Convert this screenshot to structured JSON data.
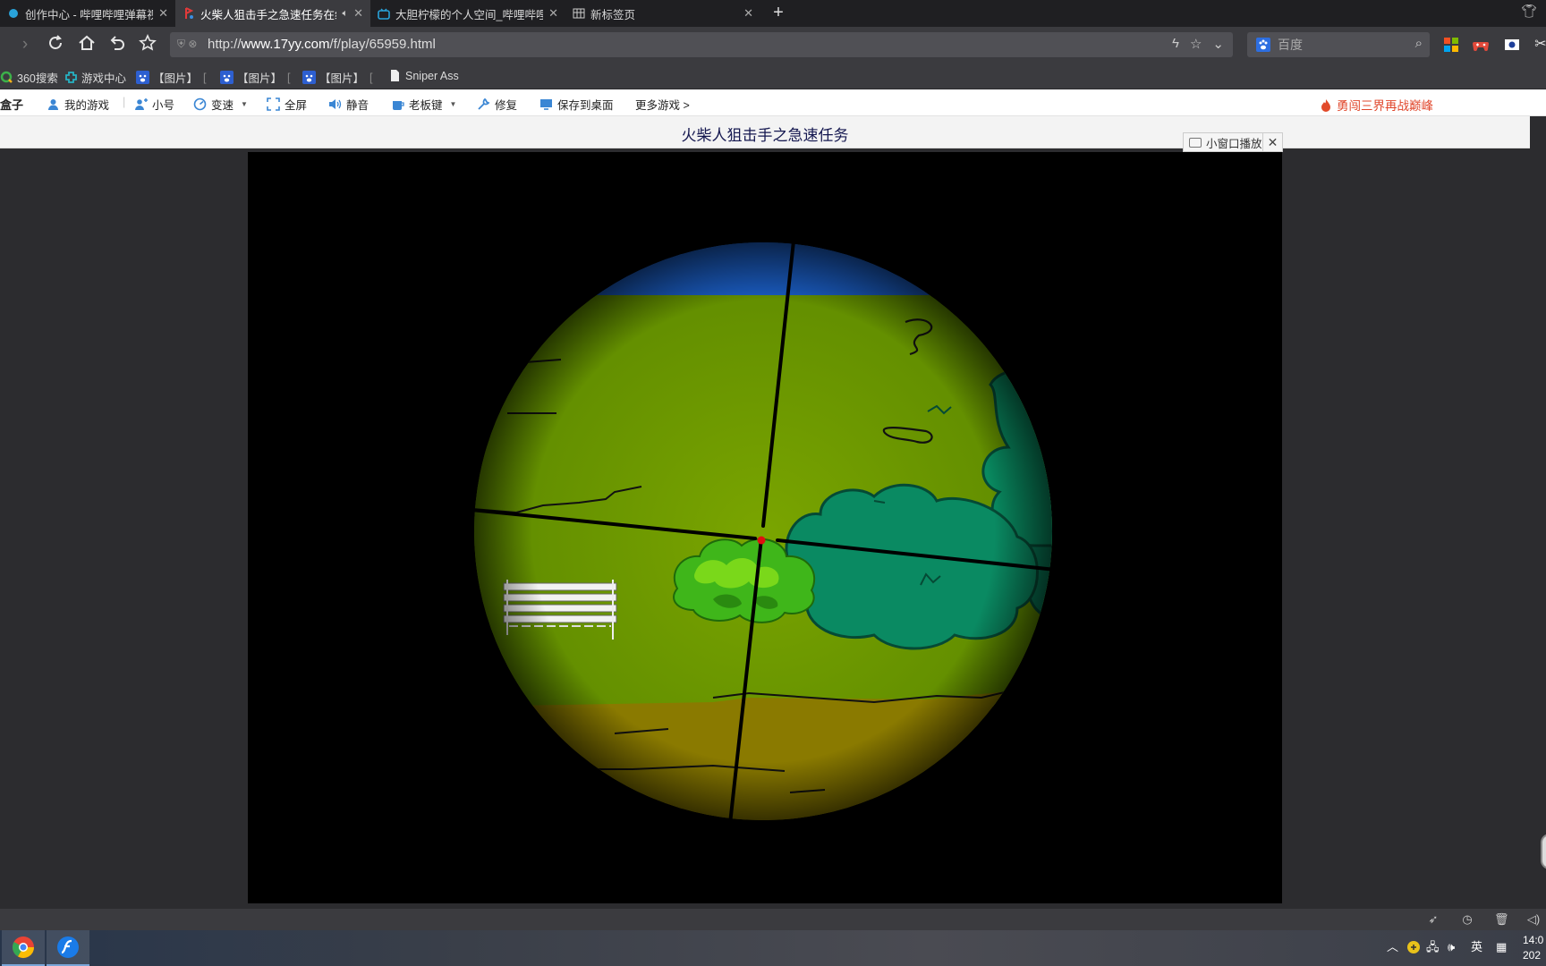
{
  "tabs": [
    {
      "title": "创作中心 - 哔哩哔哩弹幕视频",
      "active": false
    },
    {
      "title": "火柴人狙击手之急速任务在线",
      "active": true
    },
    {
      "title": "大胆柠檬的个人空间_哔哩哔哩",
      "active": false
    },
    {
      "title": "新标签页",
      "active": false
    }
  ],
  "navbar": {
    "url_prefix": "http://",
    "url_host": "www.17yy.com",
    "url_path": "/f/play/65959.html",
    "search_placeholder": "百度"
  },
  "bookmarks": [
    {
      "label": "360搜索",
      "icon": "360-search-icon"
    },
    {
      "label": "游戏中心",
      "icon": "game-center-icon"
    },
    {
      "label": "【图片】",
      "icon": "baidu-paw-icon"
    },
    {
      "label": "【图片】",
      "icon": "baidu-paw-icon"
    },
    {
      "label": "【图片】",
      "icon": "baidu-paw-icon"
    },
    {
      "label": "Sniper Ass",
      "icon": "page-icon"
    }
  ],
  "game_toolbar": {
    "brand": "盒子",
    "items": [
      {
        "label": "我的游戏",
        "icon": "user-icon"
      },
      {
        "label": "小号",
        "icon": "add-user-icon"
      },
      {
        "label": "变速",
        "icon": "speed-icon"
      },
      {
        "label": "全屏",
        "icon": "fullscreen-icon"
      },
      {
        "label": "静音",
        "icon": "speaker-icon"
      },
      {
        "label": "老板键",
        "icon": "boss-key-icon"
      },
      {
        "label": "修复",
        "icon": "wrench-icon"
      },
      {
        "label": "保存到桌面",
        "icon": "monitor-icon"
      },
      {
        "label": "更多游戏 >",
        "icon": ""
      }
    ],
    "promo": "勇闯三界再战巅峰"
  },
  "game": {
    "title": "火柴人狙击手之急速任务",
    "mini_play_label": "小窗口播放"
  },
  "taskbar": {
    "ime": "英",
    "time": "14:0",
    "date": "202"
  }
}
